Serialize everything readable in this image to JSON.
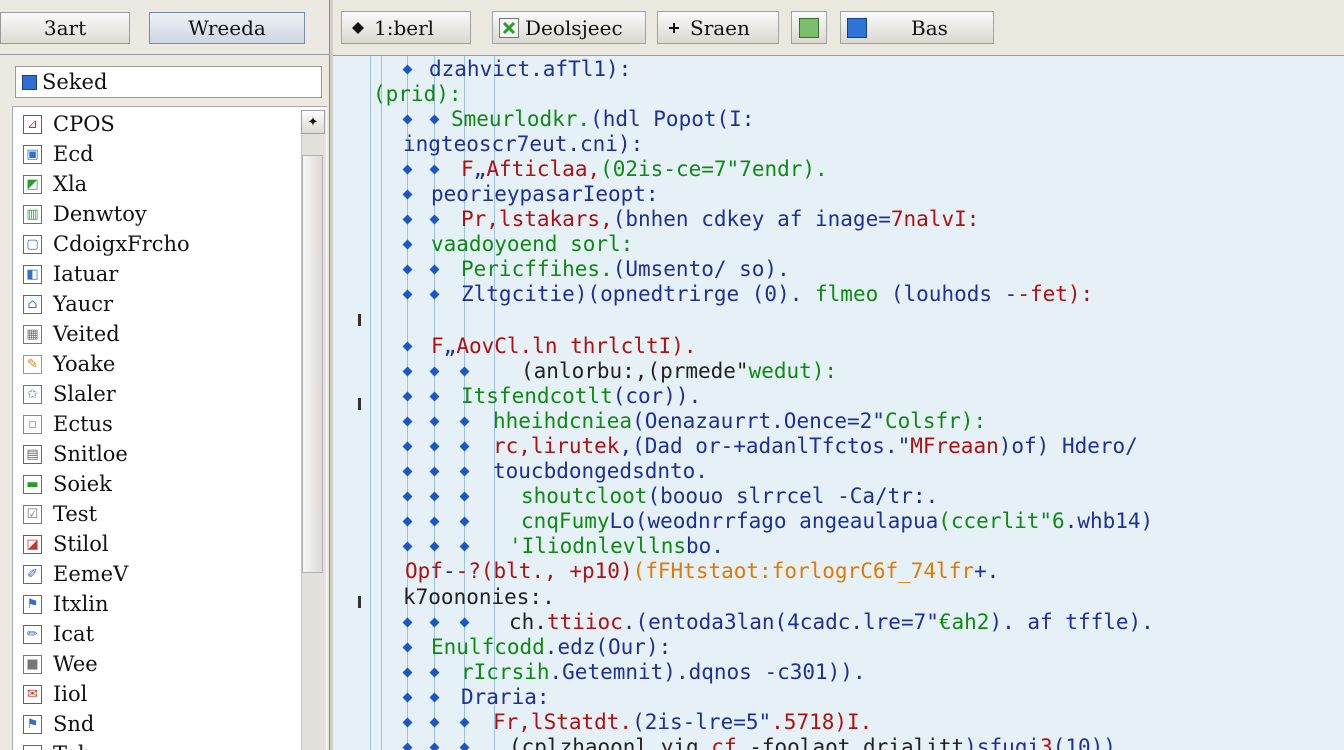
{
  "left_panel": {
    "start_label": "3art",
    "window_label": "Wreeda",
    "select_label": "Seked",
    "scroll_up_symbol": "✦",
    "items": [
      {
        "label": "CPOS",
        "icon": "red-chart-icon",
        "color": "#c0392b"
      },
      {
        "label": "Ecd",
        "icon": "blue-window-icon",
        "color": "#2e6fd0"
      },
      {
        "label": "Xla",
        "icon": "green-chart-icon",
        "color": "#2f9a3a"
      },
      {
        "label": "Denwtoy",
        "icon": "green-document-icon",
        "color": "#2f9a3a"
      },
      {
        "label": "CdoigxFrcho",
        "icon": "blue-frame-icon",
        "color": "#2e6fd0"
      },
      {
        "label": "Iatuar",
        "icon": "blue-graph-icon",
        "color": "#2e6fd0"
      },
      {
        "label": "Yaucr",
        "icon": "blue-house-icon",
        "color": "#2e6fd0"
      },
      {
        "label": "Veited",
        "icon": "gray-grid-icon",
        "color": "#777777"
      },
      {
        "label": "Yoake",
        "icon": "edit-pencil-icon",
        "color": "#e08a1a"
      },
      {
        "label": "Slaler",
        "icon": "blue-star-icon",
        "color": "#3a7fd9"
      },
      {
        "label": "Ectus",
        "icon": "gray-box-icon",
        "color": "#888888"
      },
      {
        "label": "Snitloe",
        "icon": "gray-table-icon",
        "color": "#666666"
      },
      {
        "label": "Soiek",
        "icon": "green-bar-icon",
        "color": "#2a9a2a"
      },
      {
        "label": "Test",
        "icon": "check-box-icon",
        "color": "#777777"
      },
      {
        "label": "Stilol",
        "icon": "red-graph-icon",
        "color": "#c0392b"
      },
      {
        "label": "EemeV",
        "icon": "blue-pen-icon",
        "color": "#2e6fd0"
      },
      {
        "label": "Itxlin",
        "icon": "blue-flag-icon",
        "color": "#2e6fd0"
      },
      {
        "label": "Icat",
        "icon": "blue-brush-icon",
        "color": "#2e6fd0"
      },
      {
        "label": "Wee",
        "icon": "gray-square-icon",
        "color": "#777777"
      },
      {
        "label": "Iiol",
        "icon": "red-mail-icon",
        "color": "#c0392b"
      },
      {
        "label": "Snd",
        "icon": "blue-flag-icon",
        "color": "#2e6fd0"
      },
      {
        "label": "Tab",
        "icon": "blue-arrow-icon",
        "color": "#2e6fd0"
      }
    ]
  },
  "toolbar": {
    "buttons": [
      {
        "label": "1:berl",
        "icon": "diamond-icon"
      },
      {
        "label": "Deolsjeec",
        "icon": "green-x-icon"
      },
      {
        "label": "Sraen",
        "icon": "plus-icon"
      },
      {
        "label": "",
        "icon": "image-icon"
      },
      {
        "label": "Bas",
        "icon": "blue-square-icon"
      }
    ]
  },
  "code_lines": [
    [
      {
        "text": "dzahvict.afTl1):",
        "color": "blue"
      }
    ],
    [
      {
        "text": "(prid):",
        "color": "green"
      }
    ],
    [
      {
        "text": "Smeurlodkr.",
        "color": "green"
      },
      {
        "text": "(hdl Popot(I:",
        "color": "blue"
      }
    ],
    [
      {
        "text": "ingteoscr7eut.cni):",
        "color": "blue"
      }
    ],
    [
      {
        "text": "F",
        "color": "red"
      },
      {
        "text": "„",
        "color": "blue"
      },
      {
        "text": "Afticlaa,",
        "color": "red"
      },
      {
        "text": "(02is-ce=7\"7endr).",
        "color": "green"
      }
    ],
    [
      {
        "text": "peorieypasarIeopt:",
        "color": "blue"
      }
    ],
    [
      {
        "text": "Pr,lstakars,",
        "color": "red"
      },
      {
        "text": "(bnhen cdkey af inage=",
        "color": "blue"
      },
      {
        "text": "7nalvI:",
        "color": "red"
      }
    ],
    [
      {
        "text": "vaadoyoend sorl:",
        "color": "green"
      }
    ],
    [
      {
        "text": "Pericffihes.",
        "color": "green"
      },
      {
        "text": "(Umsento/ so).",
        "color": "blue"
      }
    ],
    [
      {
        "text": "Zltgcitie)(opnedtrirge (0). ",
        "color": "blue"
      },
      {
        "text": "flmeo ",
        "color": "green"
      },
      {
        "text": "(louhods -",
        "color": "blue"
      },
      {
        "text": "-fet):",
        "color": "red"
      }
    ],
    [
      {
        "text": "F",
        "color": "red"
      },
      {
        "text": "„",
        "color": "blue"
      },
      {
        "text": "AovCl.ln ",
        "color": "red"
      },
      {
        "text": "thrlcltI).",
        "color": "red"
      }
    ],
    [
      {
        "text": "(anlorbu:,(prmede\"",
        "color": "dark"
      },
      {
        "text": "wedut):",
        "color": "green"
      }
    ],
    [
      {
        "text": "Itsfendcotlt",
        "color": "green"
      },
      {
        "text": "(cor)).",
        "color": "blue"
      }
    ],
    [
      {
        "text": "hheihdcniea",
        "color": "green"
      },
      {
        "text": "(Oenazaurrt.Oence=2\"",
        "color": "blue"
      },
      {
        "text": "Colsfr):",
        "color": "green"
      }
    ],
    [
      {
        "text": "rc,lirutek",
        "color": "red"
      },
      {
        "text": ",(Dad or-+adanlTfctos.\"",
        "color": "blue"
      },
      {
        "text": "MFreaan",
        "color": "red"
      },
      {
        "text": ")of) Hdero/",
        "color": "blue"
      }
    ],
    [
      {
        "text": "toucbdonged",
        "color": "blue"
      },
      {
        "text": "sdnto.",
        "color": "blue"
      }
    ],
    [
      {
        "text": "shoutcloot",
        "color": "green"
      },
      {
        "text": "(boouo slrrcel -Ca/tr:.",
        "color": "blue"
      }
    ],
    [
      {
        "text": "cnqFumy",
        "color": "green"
      },
      {
        "text": "Lo",
        "color": "blue"
      },
      {
        "text": "(weodnrrfago angeaulapua",
        "color": "blue"
      },
      {
        "text": "(ccerlit\"6",
        "color": "green"
      },
      {
        "text": ".whb14)",
        "color": "blue"
      }
    ],
    [
      {
        "text": "'Iliodnlevllns",
        "color": "green"
      },
      {
        "text": "bo.",
        "color": "blue"
      }
    ],
    [
      {
        "text": "Opf",
        "color": "red"
      },
      {
        "text": "-",
        "color": "blue"
      },
      {
        "text": "-?(blt",
        "color": "red"
      },
      {
        "text": "., +p10)",
        "color": "red"
      },
      {
        "text": "(fFHtstaot:forlogr",
        "color": "orange"
      },
      {
        "text": "C6f_74lfr",
        "color": "orange"
      },
      {
        "text": "+.",
        "color": "blue"
      }
    ],
    [
      {
        "text": "k7oononies:.",
        "color": "dark"
      }
    ],
    [
      {
        "text": "ch.",
        "color": "dark"
      },
      {
        "text": "ttiioc",
        "color": "red"
      },
      {
        "text": ".(entoda3lan(4cadc.lre=7\"",
        "color": "blue"
      },
      {
        "text": "€ah2",
        "color": "green"
      },
      {
        "text": "). af tffle).",
        "color": "blue"
      }
    ],
    [
      {
        "text": "Enulfcodd",
        "color": "green"
      },
      {
        "text": ".edz(Our):",
        "color": "blue"
      }
    ],
    [
      {
        "text": "rIcrsih",
        "color": "green"
      },
      {
        "text": ".Getemnit).dqnos -c301)).",
        "color": "blue"
      }
    ],
    [
      {
        "text": "Draria:",
        "color": "blue"
      }
    ],
    [
      {
        "text": "Fr,lStatdt.",
        "color": "red"
      },
      {
        "text": "(2is-lre=5\"",
        "color": "blue"
      },
      {
        "text": ".5718)I.",
        "color": "red"
      }
    ],
    [
      {
        "text": "(cplzhaoonl.yig",
        "color": "dark"
      },
      {
        "text": " cf ",
        "color": "red"
      },
      {
        "text": "-foolaot drialitt",
        "color": "dark"
      },
      {
        "text": ")sfuqi",
        "color": "blue"
      },
      {
        "text": "3",
        "color": "red"
      },
      {
        "text": "(10))",
        "color": "blue"
      }
    ]
  ]
}
